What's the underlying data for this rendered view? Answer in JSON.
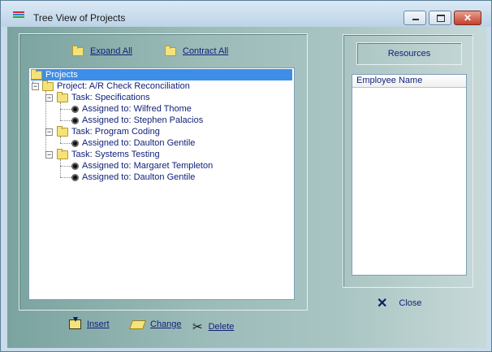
{
  "window": {
    "title": "Tree View of Projects",
    "controls": {
      "minimize": "",
      "maximize": "",
      "close": "✕"
    }
  },
  "toolbar": {
    "expand_all": "Expand All",
    "contract_all": "Contract All"
  },
  "tree": {
    "root": "Projects",
    "project": "Project: A/R Check Reconciliation",
    "task1": "Task: Specifications",
    "a1": "Assigned to: Wilfred Thome",
    "a2": "Assigned to: Stephen Palacios",
    "task2": "Task: Program Coding",
    "a3": "Assigned to: Daulton Gentile",
    "task3": "Task: Systems Testing",
    "a4": "Assigned to: Margaret Templeton",
    "a5": "Assigned to: Daulton Gentile"
  },
  "resources": {
    "title": "Resources",
    "column": "Employee Name"
  },
  "actions": {
    "insert": "Insert",
    "change": "Change",
    "delete": "Delete",
    "close": "Close"
  },
  "colors": {
    "accent": "#0f1f77",
    "selection": "#3d8ee8"
  }
}
